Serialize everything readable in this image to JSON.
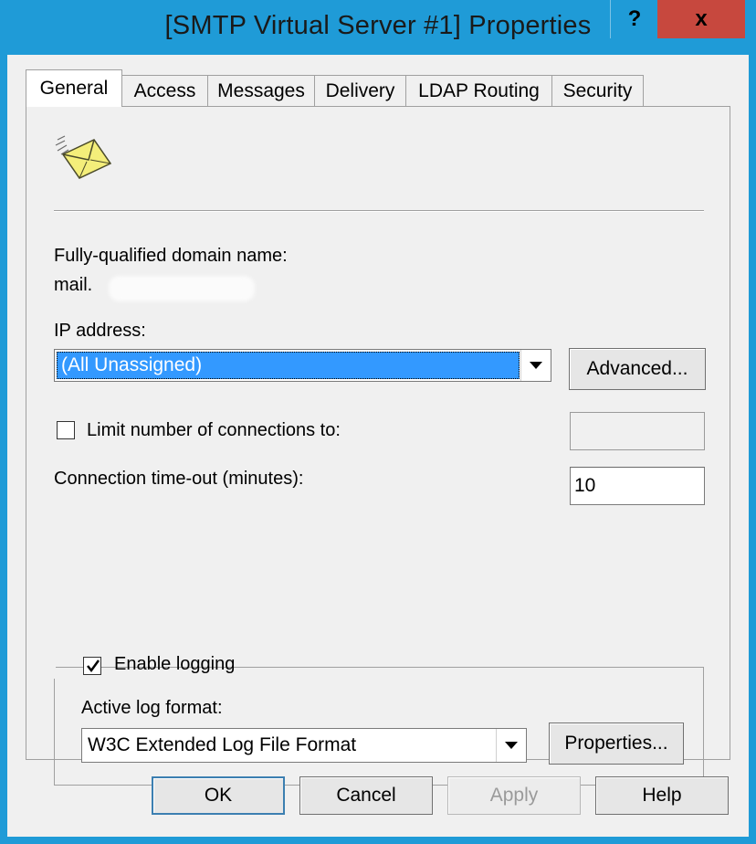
{
  "window": {
    "title": "[SMTP Virtual Server #1] Properties",
    "help_glyph": "?",
    "close_glyph": "x"
  },
  "tabs": [
    {
      "label": "General",
      "active": true
    },
    {
      "label": "Access",
      "active": false
    },
    {
      "label": "Messages",
      "active": false
    },
    {
      "label": "Delivery",
      "active": false
    },
    {
      "label": "LDAP Routing",
      "active": false
    },
    {
      "label": "Security",
      "active": false
    }
  ],
  "general": {
    "icon": "envelope-icon",
    "fqdn_label": "Fully-qualified domain name:",
    "fqdn_value": "mail.",
    "ip_label": "IP address:",
    "ip_value": "(All Unassigned)",
    "advanced_button": "Advanced...",
    "limit_connections_label": "Limit number of connections to:",
    "limit_connections_checked": false,
    "limit_connections_value": "",
    "timeout_label": "Connection time-out (minutes):",
    "timeout_value": "10",
    "logging": {
      "enable_label": "Enable logging",
      "enabled": true,
      "format_label": "Active log format:",
      "format_value": "W3C Extended Log File Format",
      "properties_button": "Properties..."
    }
  },
  "footer": {
    "ok": "OK",
    "cancel": "Cancel",
    "apply": "Apply",
    "help": "Help"
  },
  "colors": {
    "title_bar": "#1f9bd7",
    "close_button": "#c7483e",
    "selection": "#3399ff"
  }
}
